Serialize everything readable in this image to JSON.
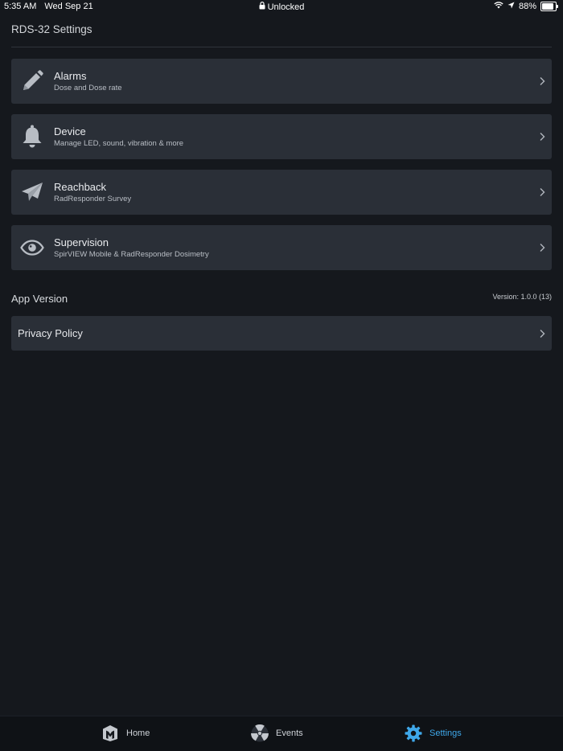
{
  "status_bar": {
    "time": "5:35 AM",
    "date": "Wed Sep 21",
    "lock_status": "Unlocked",
    "battery": "88%",
    "battery_level": 0.88
  },
  "header": {
    "title": "RDS-32 Settings"
  },
  "settings_items": [
    {
      "title": "Alarms",
      "subtitle": "Dose and Dose rate",
      "icon": "pencil-icon"
    },
    {
      "title": "Device",
      "subtitle": "Manage LED, sound, vibration & more",
      "icon": "bell-icon"
    },
    {
      "title": "Reachback",
      "subtitle": "RadResponder Survey",
      "icon": "paper-plane-icon"
    },
    {
      "title": "Supervision",
      "subtitle": "SpirVIEW Mobile & RadResponder Dosimetry",
      "icon": "eye-icon"
    }
  ],
  "app_version": {
    "section_title": "App Version",
    "version": "Version: 1.0.0 (13)"
  },
  "privacy": {
    "label": "Privacy Policy"
  },
  "tab_bar": {
    "tabs": [
      {
        "label": "Home",
        "icon": "home-logo-icon",
        "active": false
      },
      {
        "label": "Events",
        "icon": "radiation-icon",
        "active": false
      },
      {
        "label": "Settings",
        "icon": "gear-icon",
        "active": true
      }
    ],
    "active_color": "#3fa8ea"
  }
}
